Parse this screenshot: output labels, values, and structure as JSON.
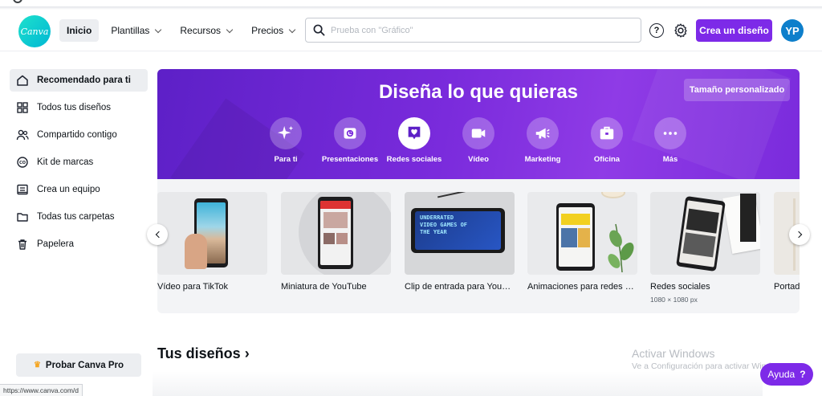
{
  "header": {
    "logo_text": "Canva",
    "nav": [
      {
        "label": "Inicio",
        "active": true
      },
      {
        "label": "Plantillas"
      },
      {
        "label": "Recursos"
      },
      {
        "label": "Precios"
      }
    ],
    "search_placeholder": "Prueba con \"Gráfico\"",
    "help_label": "?",
    "create_label": "Crea un diseño",
    "avatar_initials": "YP"
  },
  "sidebar": {
    "items": [
      {
        "label": "Recomendado para ti",
        "icon": "home-icon"
      },
      {
        "label": "Todos tus diseños",
        "icon": "grid-icon"
      },
      {
        "label": "Compartido contigo",
        "icon": "users-icon"
      },
      {
        "label": "Kit de marcas",
        "icon": "brand-kit-icon"
      },
      {
        "label": "Crea un equipo",
        "icon": "team-icon"
      },
      {
        "label": "Todas tus carpetas",
        "icon": "folder-icon"
      },
      {
        "label": "Papelera",
        "icon": "trash-icon"
      }
    ],
    "pro_label": "Probar Canva Pro",
    "pro_icon": "♛"
  },
  "hero": {
    "title": "Diseña lo que quieras",
    "custom_size_label": "Tamaño personalizado",
    "categories": [
      {
        "label": "Para ti",
        "icon": "sparkle-icon"
      },
      {
        "label": "Presentaciones",
        "icon": "presentation-icon"
      },
      {
        "label": "Redes sociales",
        "icon": "heart-chat-icon",
        "active": true
      },
      {
        "label": "Vídeo",
        "icon": "video-camera-icon"
      },
      {
        "label": "Marketing",
        "icon": "megaphone-icon"
      },
      {
        "label": "Oficina",
        "icon": "briefcase-icon"
      },
      {
        "label": "Más",
        "icon": "more-dots-icon"
      }
    ]
  },
  "carousel": {
    "cards": [
      {
        "title": "Vídeo para TikTok",
        "subtitle": ""
      },
      {
        "title": "Miniatura de YouTube",
        "subtitle": ""
      },
      {
        "title": "Clip de entrada para YouTube",
        "subtitle": "",
        "thumb_text": "UNDERRATED VIDEO GAMES OF THE YEAR"
      },
      {
        "title": "Animaciones para redes sociales",
        "subtitle": ""
      },
      {
        "title": "Redes sociales",
        "subtitle": "1080 × 1080 px"
      },
      {
        "title": "Portada",
        "subtitle": ""
      }
    ]
  },
  "section_title": "Tus diseños",
  "section_chevron": "›",
  "watermark": {
    "title": "Activar Windows",
    "subtitle": "Ve a Configuración para activar Windows."
  },
  "help_fab": {
    "label": "Ayuda",
    "icon": "?"
  },
  "status_url": "https://www.canva.com/d",
  "colors": {
    "accent": "#7d2ae8",
    "avatar": "#0e7fcb",
    "logo": "#00c4cc"
  }
}
